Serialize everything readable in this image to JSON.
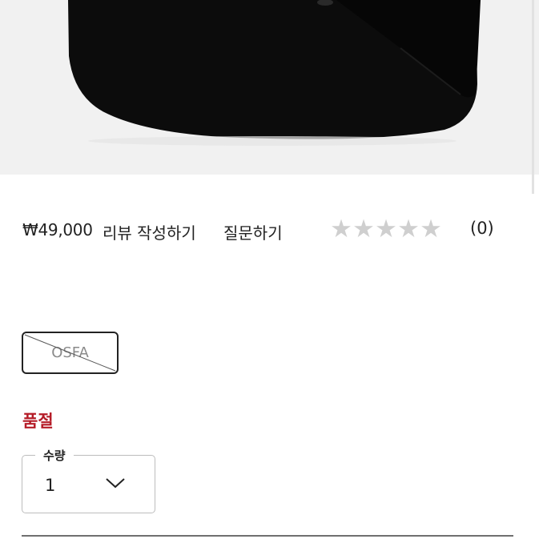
{
  "product": {
    "price": "₩49,000",
    "write_review_label": "리뷰 작성하기",
    "ask_question_label": "질문하기",
    "rating_stars": 0,
    "rating_max": 5,
    "review_count": "(0)",
    "image_colors": {
      "background": "#f1f1f1",
      "bag": "#0b0b0b"
    }
  },
  "options": {
    "size_label": "OSFA",
    "size_available": false,
    "stock_status": "품절",
    "stock_status_color": "#b51c28"
  },
  "quantity": {
    "legend": "수량",
    "value": "1"
  }
}
